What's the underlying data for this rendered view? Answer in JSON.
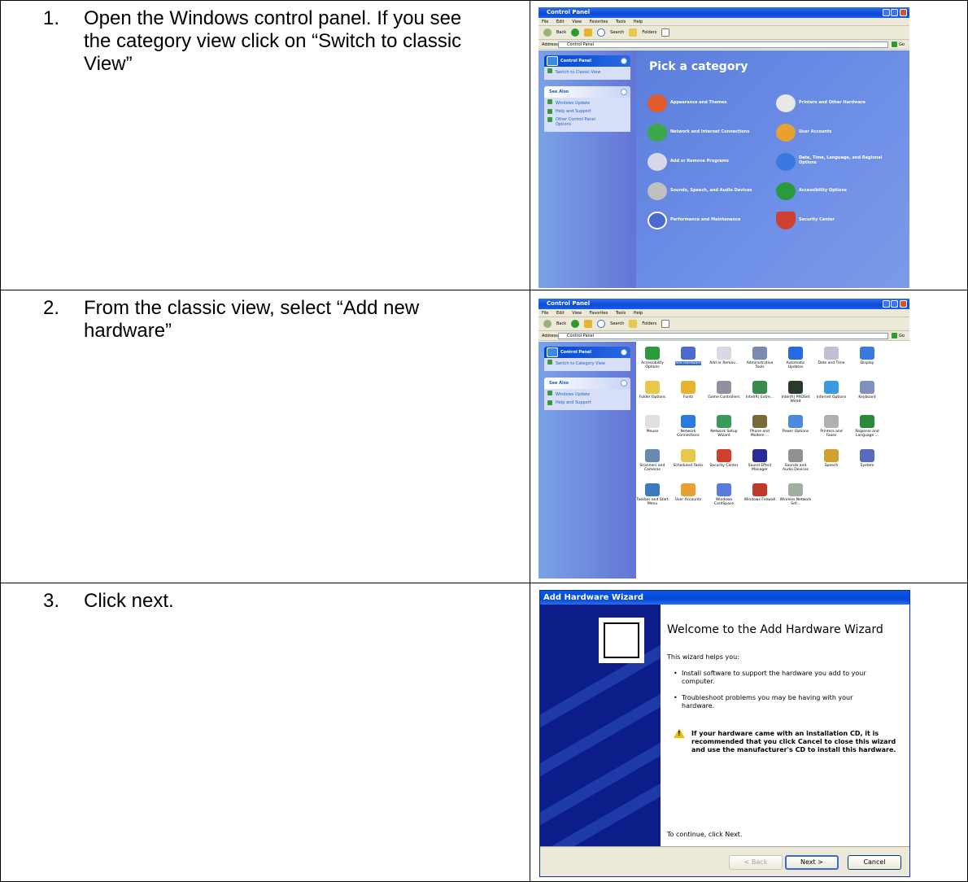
{
  "steps": [
    {
      "number": "1.",
      "text": "Open the Windows control panel.  If you see the category view click on “Switch to classic View”"
    },
    {
      "number": "2.",
      "text": "From the classic view, select “Add new hardware”"
    },
    {
      "number": "3.",
      "text": "Click next."
    }
  ],
  "window": {
    "title": "Control Panel",
    "menu": [
      "File",
      "Edit",
      "View",
      "Favorites",
      "Tools",
      "Help"
    ],
    "toolbar": {
      "back": "Back",
      "search": "Search",
      "folders": "Folders"
    },
    "address_label": "Address",
    "address_value": "Control Panel",
    "go": "Go"
  },
  "category_view": {
    "panel_title": "Control Panel",
    "switch_link": "Switch to Classic View",
    "see_also": "See Also",
    "see_also_links": [
      "Windows Update",
      "Help and Support",
      "Other Control Panel Options"
    ],
    "heading": "Pick a category",
    "categories": [
      "Appearance and Themes",
      "Printers and Other Hardware",
      "Network and Internet Connections",
      "User Accounts",
      "Add or Remove Programs",
      "Date, Time, Language, and Regional Options",
      "Sounds, Speech, and Audio Devices",
      "Accessibility Options",
      "Performance and Maintenance",
      "Security Center"
    ]
  },
  "classic_view": {
    "panel_title": "Control Panel",
    "switch_link": "Switch to Category View",
    "see_also": "See Also",
    "see_also_links": [
      "Windows Update",
      "Help and Support"
    ],
    "items": [
      "Accessibility Options",
      "Add Hardware",
      "Add or Remov...",
      "Administrative Tools",
      "Automatic Updates",
      "Date and Time",
      "Display",
      "Folder Options",
      "Fonts",
      "Game Controllers",
      "Intel(R) Extre...",
      "Intel(R) PROSet Wired",
      "Internet Options",
      "Keyboard",
      "Mouse",
      "Network Connections",
      "Network Setup Wizard",
      "Phone and Modem ...",
      "Power Options",
      "Printers and Faxes",
      "Regional and Language ...",
      "Scanners and Cameras",
      "Scheduled Tasks",
      "Security Center",
      "Sound Effect Manager",
      "Sounds and Audio Devices",
      "Speech",
      "System",
      "Taskbar and Start Menu",
      "User Accounts",
      "Windows CardSpace",
      "Windows Firewall",
      "Wireless Network Set..."
    ],
    "selected_item": "Add Hardware"
  },
  "wizard": {
    "title": "Add Hardware Wizard",
    "heading": "Welcome to the Add Hardware Wizard",
    "intro": "This wizard helps you:",
    "bullets": [
      "Install software to support the hardware you add to your computer.",
      "Troubleshoot problems you may be having with your hardware."
    ],
    "warning": "If your hardware came with an installation CD, it is recommended that you click Cancel to close this wizard and use the manufacturer's CD to install this hardware.",
    "continue": "To continue, click Next.",
    "buttons": {
      "back": "< Back",
      "next": "Next >",
      "cancel": "Cancel"
    }
  }
}
